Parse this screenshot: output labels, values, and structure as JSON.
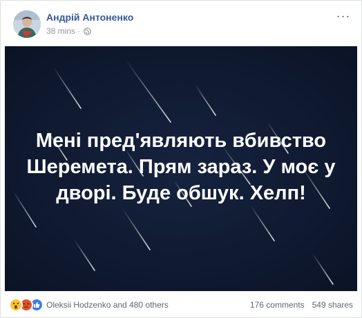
{
  "post": {
    "author": "Андрій Антоненко",
    "time": "38 mins",
    "separator": "·",
    "privacy_icon": "globe-icon",
    "menu_icon": "more-options-icon",
    "more_label": "···"
  },
  "image": {
    "caption": "Мені пред'являють вбивство Шеремета. Прям зараз. У моє у дворі. Буде обшук. Хелп!",
    "background_color": "#101b33"
  },
  "footer": {
    "reactions": [
      "wow-reaction-icon",
      "angry-reaction-icon",
      "like-reaction-icon"
    ],
    "reacted_by": "Oleksii Hodzenko and 480 others",
    "comments": "176 comments",
    "shares": "549 shares"
  },
  "colors": {
    "author_link": "#365899",
    "meta_text": "#90949c"
  }
}
